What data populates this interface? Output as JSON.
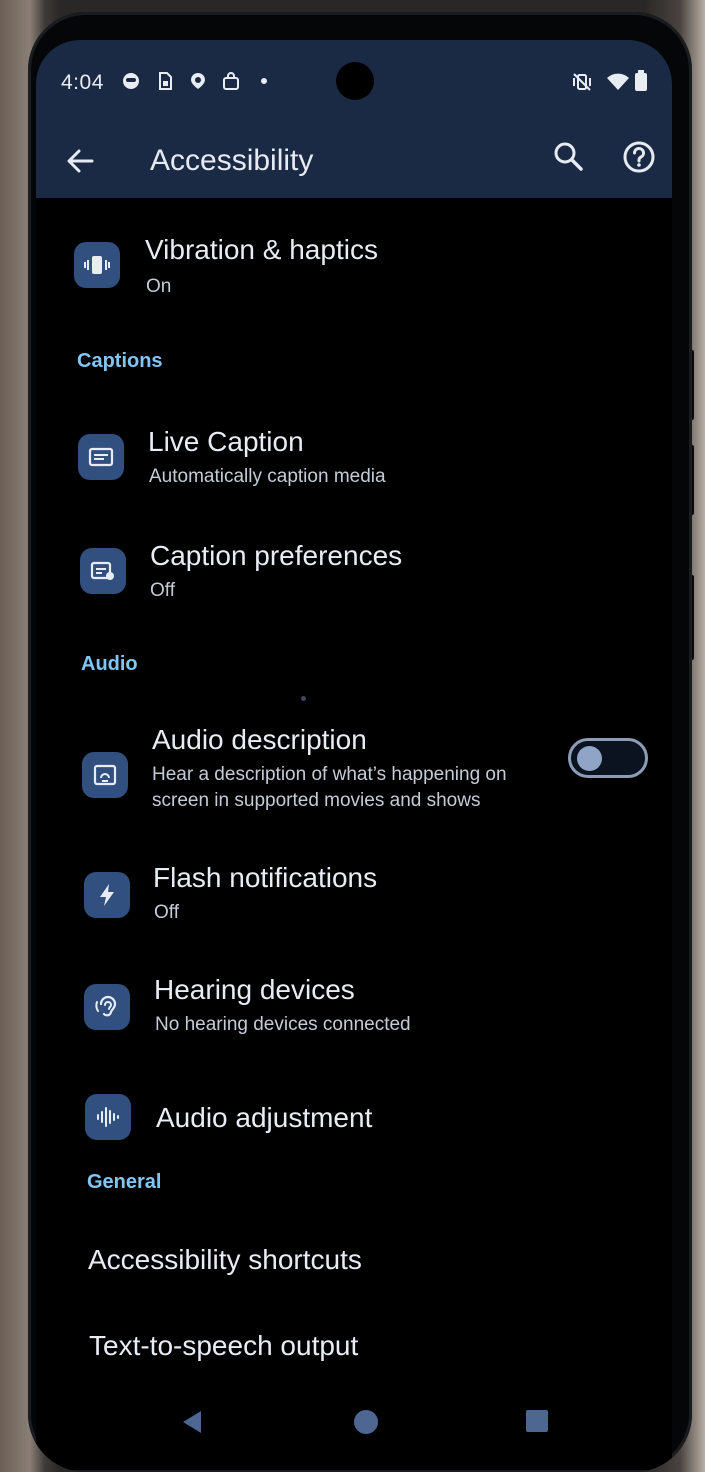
{
  "status_bar": {
    "time": "4:04",
    "left_icons": [
      "face-notification-icon",
      "sim-icon",
      "location-pin-icon",
      "shopping-bag-icon",
      "notification-dot-icon"
    ],
    "right_icons": [
      "vibrate-off-icon",
      "wifi-icon",
      "battery-icon"
    ]
  },
  "app_bar": {
    "title": "Accessibility"
  },
  "items": {
    "vibration": {
      "title": "Vibration & haptics",
      "subtitle": "On"
    },
    "live_caption": {
      "title": "Live Caption",
      "subtitle": "Automatically caption media"
    },
    "caption_prefs": {
      "title": "Caption preferences",
      "subtitle": "Off"
    },
    "audio_description": {
      "title": "Audio description",
      "subtitle_line1": "Hear a description of what’s happening on",
      "subtitle_line2": "screen in supported movies and shows",
      "toggle_on": false
    },
    "flash_notifications": {
      "title": "Flash notifications",
      "subtitle": "Off"
    },
    "hearing_devices": {
      "title": "Hearing devices",
      "subtitle": "No hearing devices connected"
    },
    "audio_adjustment": {
      "title": "Audio adjustment"
    },
    "accessibility_shortcuts": {
      "title": "Accessibility shortcuts"
    },
    "tts_output": {
      "title": "Text-to-speech output"
    }
  },
  "sections": {
    "captions": "Captions",
    "audio": "Audio",
    "general": "General"
  },
  "colors": {
    "accent": "#7fc6f2",
    "icon_bg": "#32507f",
    "app_bar_bg": "#1b2a44",
    "background": "#000000"
  }
}
